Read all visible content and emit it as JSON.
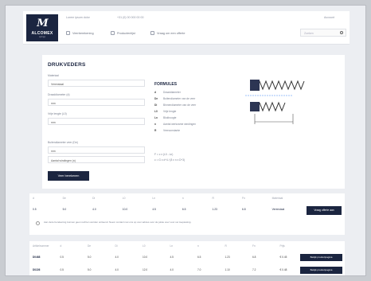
{
  "header": {
    "logo_mark": "M",
    "logo_name": "ALCOMEX",
    "logo_sub": "springs",
    "address": "Lorem ipsum dolor",
    "phone": "+31 (0) 00 000 00 00",
    "account": "Account",
    "nav": [
      "Veerberekening",
      "Productenlijst",
      "Vraag om een offerte"
    ],
    "search_placeholder": "Zoeken"
  },
  "calculator": {
    "title": "DRUKVEDERS",
    "fields": [
      {
        "label": "Materiaal",
        "value": "Verenstaal"
      },
      {
        "label": "Draaddiameter (d)",
        "value": "mm"
      },
      {
        "label": "Vrije lengte (L0)",
        "value": "mm"
      },
      {
        "label": "Buitendiameter veer (De)",
        "value": "mm"
      }
    ],
    "extra_field": "Aantal windingen (n)",
    "button": "Veer berekenen",
    "formulas_title": "FORMULES",
    "formulas": [
      {
        "sym": "d",
        "text": "Draaddiameter"
      },
      {
        "sym": "De",
        "text": "Buitendiameter van de veer"
      },
      {
        "sym": "Di",
        "text": "Binnendiameter van de veer"
      },
      {
        "sym": "L0",
        "text": "Vrije lengte"
      },
      {
        "sym": "Ln",
        "text": "Blokhoogte"
      },
      {
        "sym": "n",
        "text": "Aantal werkzame windingen"
      },
      {
        "sym": "R",
        "text": "Veerconstante"
      }
    ],
    "notes": [
      "F = c x (L0 - Ln)",
      "c = G x d^4 / (8 x n x D^3)"
    ]
  },
  "result": {
    "headers": [
      "d",
      "De",
      "Di",
      "L0",
      "Ln",
      "n",
      "R",
      "Fn",
      "Materiaal"
    ],
    "values": [
      "0.5",
      "5.0",
      "4.0",
      "10.0",
      "4.5",
      "6.5",
      "1.23",
      "6.8",
      "Verenstaal"
    ],
    "button": "Vraag offerte aan",
    "note": "Aan deze berekening kunnen geen rechten worden ontleend. Neem contact met ons op voor advies over de juiste veer voor uw toepassing."
  },
  "table": {
    "headers": [
      "Artikelnummer",
      "d",
      "De",
      "Di",
      "L0",
      "Ln",
      "n",
      "R",
      "Fn",
      "Prijs"
    ],
    "rows": [
      {
        "cells": [
          "D0468",
          "0.5",
          "5.0",
          "4.0",
          "10.0",
          "4.5",
          "6.5",
          "1.23",
          "6.8",
          "€ 0.45"
        ],
        "button": "Bekijk productpagina"
      },
      {
        "cells": [
          "D0226",
          "0.5",
          "5.0",
          "4.0",
          "12.0",
          "4.0",
          "7.0",
          "1.10",
          "7.2",
          "€ 0.48"
        ],
        "button": "Bekijk productpagina"
      }
    ]
  }
}
